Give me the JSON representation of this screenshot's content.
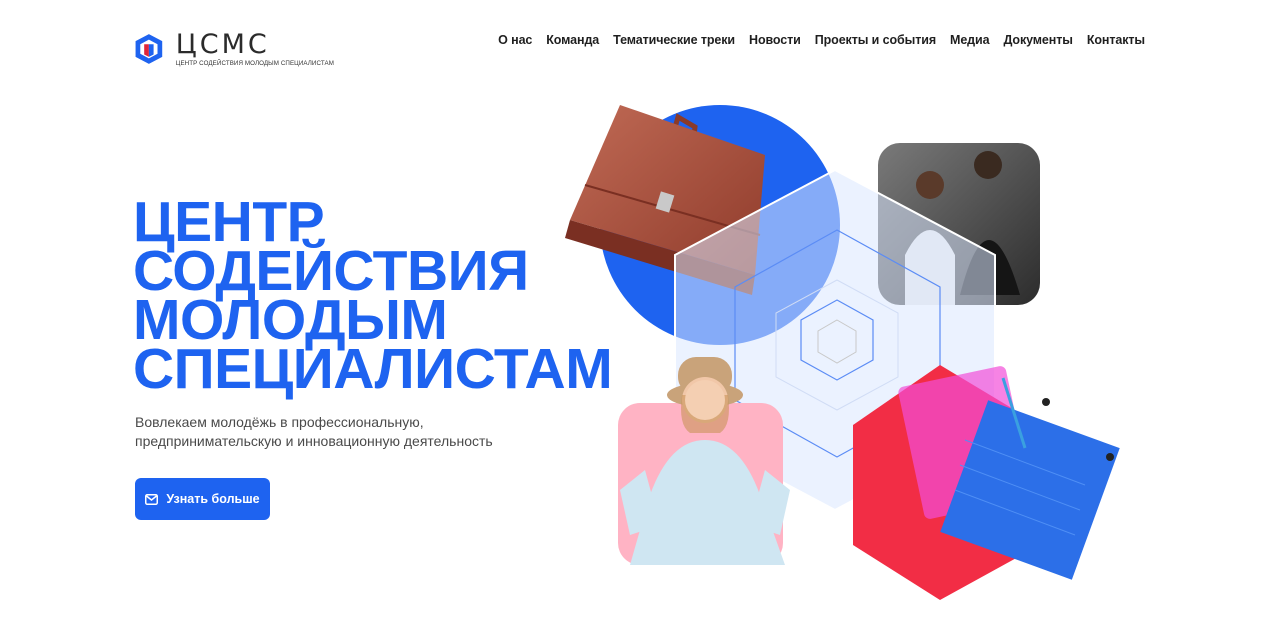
{
  "logo": {
    "word": "ЦСМС",
    "subtitle": "ЦЕНТР СОДЕЙСТВИЯ МОЛОДЫМ СПЕЦИАЛИСТАМ"
  },
  "nav": {
    "items": [
      {
        "label": "О нас"
      },
      {
        "label": "Команда"
      },
      {
        "label": "Тематические треки"
      },
      {
        "label": "Новости"
      },
      {
        "label": "Проекты и события"
      },
      {
        "label": "Медиа"
      },
      {
        "label": "Документы"
      },
      {
        "label": "Контакты"
      }
    ]
  },
  "hero": {
    "title_lines": [
      "ЦЕНТР",
      "СОДЕЙСТВИЯ",
      "МОЛОДЫМ",
      "СПЕЦИАЛИСТАМ"
    ],
    "subtitle": "Вовлекаем молодёжь в профессиональную, предпринимательскую и инновационную деятельность",
    "cta_label": "Узнать больше",
    "cta_icon": "envelope-icon"
  },
  "colors": {
    "primary": "#1e63f0",
    "accent_red": "#e0263a",
    "pink": "#ffb3c4",
    "magenta": "#f24fd8"
  }
}
